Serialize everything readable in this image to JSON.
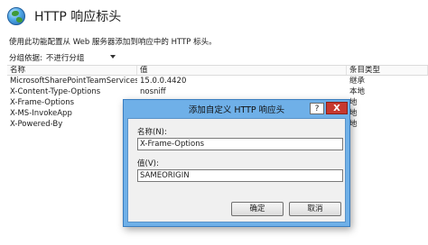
{
  "header": {
    "title": "HTTP 响应标头",
    "icon": "globe-icon"
  },
  "description": "使用此功能配置从 Web 服务器添加到响应中的 HTTP 标头。",
  "group": {
    "label": "分组依据:",
    "value": "不进行分组"
  },
  "table": {
    "columns": [
      "名称",
      "值",
      "条目类型"
    ],
    "rows": [
      {
        "name": "MicrosoftSharePointTeamServices",
        "value": "15.0.0.4420",
        "type": "继承"
      },
      {
        "name": "X-Content-Type-Options",
        "value": "nosniff",
        "type": "本地"
      },
      {
        "name": "X-Frame-Options",
        "value": "",
        "type": "地"
      },
      {
        "name": "X-MS-InvokeApp",
        "value": "",
        "type": "地"
      },
      {
        "name": "X-Powered-By",
        "value": "",
        "type": "地"
      }
    ]
  },
  "dialog": {
    "title": "添加自定义 HTTP 响应头",
    "help_label": "?",
    "close_label": "X",
    "name_label": "名称(N):",
    "name_value": "X-Frame-Options",
    "value_label": "值(V):",
    "value_value": "SAMEORIGIN",
    "ok_label": "确定",
    "cancel_label": "取消"
  }
}
